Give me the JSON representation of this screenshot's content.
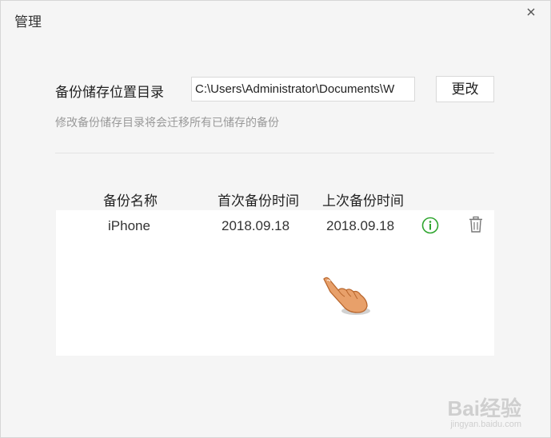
{
  "window": {
    "title": "管理",
    "close_icon": "close-icon"
  },
  "backup_dir": {
    "label": "备份储存位置目录",
    "path_value": "C:\\Users\\Administrator\\Documents\\W",
    "change_button": "更改",
    "hint": "修改备份储存目录将会迁移所有已储存的备份"
  },
  "table": {
    "headers": {
      "name": "备份名称",
      "first_time": "首次备份时间",
      "last_time": "上次备份时间"
    },
    "rows": [
      {
        "name": "iPhone",
        "first_time": "2018.09.18",
        "last_time": "2018.09.18",
        "info_icon": "info-icon",
        "delete_icon": "trash-icon"
      }
    ]
  },
  "colors": {
    "info_green": "#2ea52e",
    "hint_gray": "#999999",
    "background": "#f5f5f5"
  },
  "watermark": {
    "logo": "Bai经验",
    "url": "jingyan.baidu.com"
  }
}
